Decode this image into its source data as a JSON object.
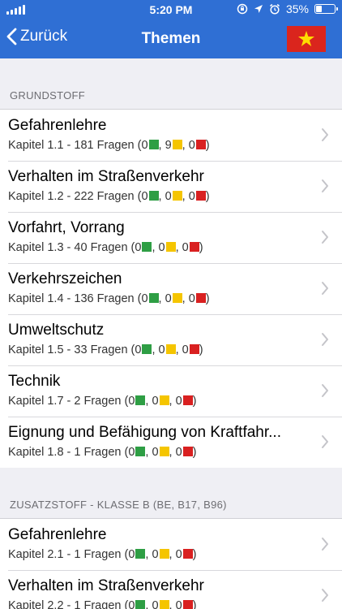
{
  "status_bar": {
    "time": "5:20 PM",
    "battery": "35%",
    "battery_level": 0.35
  },
  "nav": {
    "back_label": "Zurück",
    "title": "Themen",
    "flag_icon": "vietnam-flag"
  },
  "colors": {
    "header": "#2f6fd4",
    "green": "#2e9e44",
    "yellow": "#f5c500",
    "red": "#d92020"
  },
  "sections": [
    {
      "header": "GRUNDSTOFF",
      "rows": [
        {
          "title": "Gefahrenlehre",
          "chapter": "Kapitel 1.1 - 181 Fragen",
          "green": "0",
          "yellow": "9",
          "red": "0"
        },
        {
          "title": "Verhalten im Straßenverkehr",
          "chapter": "Kapitel 1.2 - 222 Fragen",
          "green": "0",
          "yellow": "0",
          "red": "0"
        },
        {
          "title": "Vorfahrt, Vorrang",
          "chapter": "Kapitel 1.3 - 40 Fragen",
          "green": "0",
          "yellow": "0",
          "red": "0"
        },
        {
          "title": "Verkehrszeichen",
          "chapter": "Kapitel 1.4 - 136 Fragen",
          "green": "0",
          "yellow": "0",
          "red": "0"
        },
        {
          "title": "Umweltschutz",
          "chapter": "Kapitel 1.5 - 33 Fragen",
          "green": "0",
          "yellow": "0",
          "red": "0"
        },
        {
          "title": "Technik",
          "chapter": "Kapitel 1.7 - 2 Fragen",
          "green": "0",
          "yellow": "0",
          "red": "0"
        },
        {
          "title": "Eignung und Befähigung von Kraftfahr...",
          "chapter": "Kapitel 1.8 - 1 Fragen",
          "green": "0",
          "yellow": "0",
          "red": "0"
        }
      ]
    },
    {
      "header": "ZUSATZSTOFF - KLASSE B (BE, B17, B96)",
      "rows": [
        {
          "title": "Gefahrenlehre",
          "chapter": "Kapitel 2.1 - 1 Fragen",
          "green": "0",
          "yellow": "0",
          "red": "0"
        },
        {
          "title": "Verhalten im Straßenverkehr",
          "chapter": "Kapitel 2.2 - 1 Fragen",
          "green": "0",
          "yellow": "0",
          "red": "0"
        }
      ]
    }
  ]
}
